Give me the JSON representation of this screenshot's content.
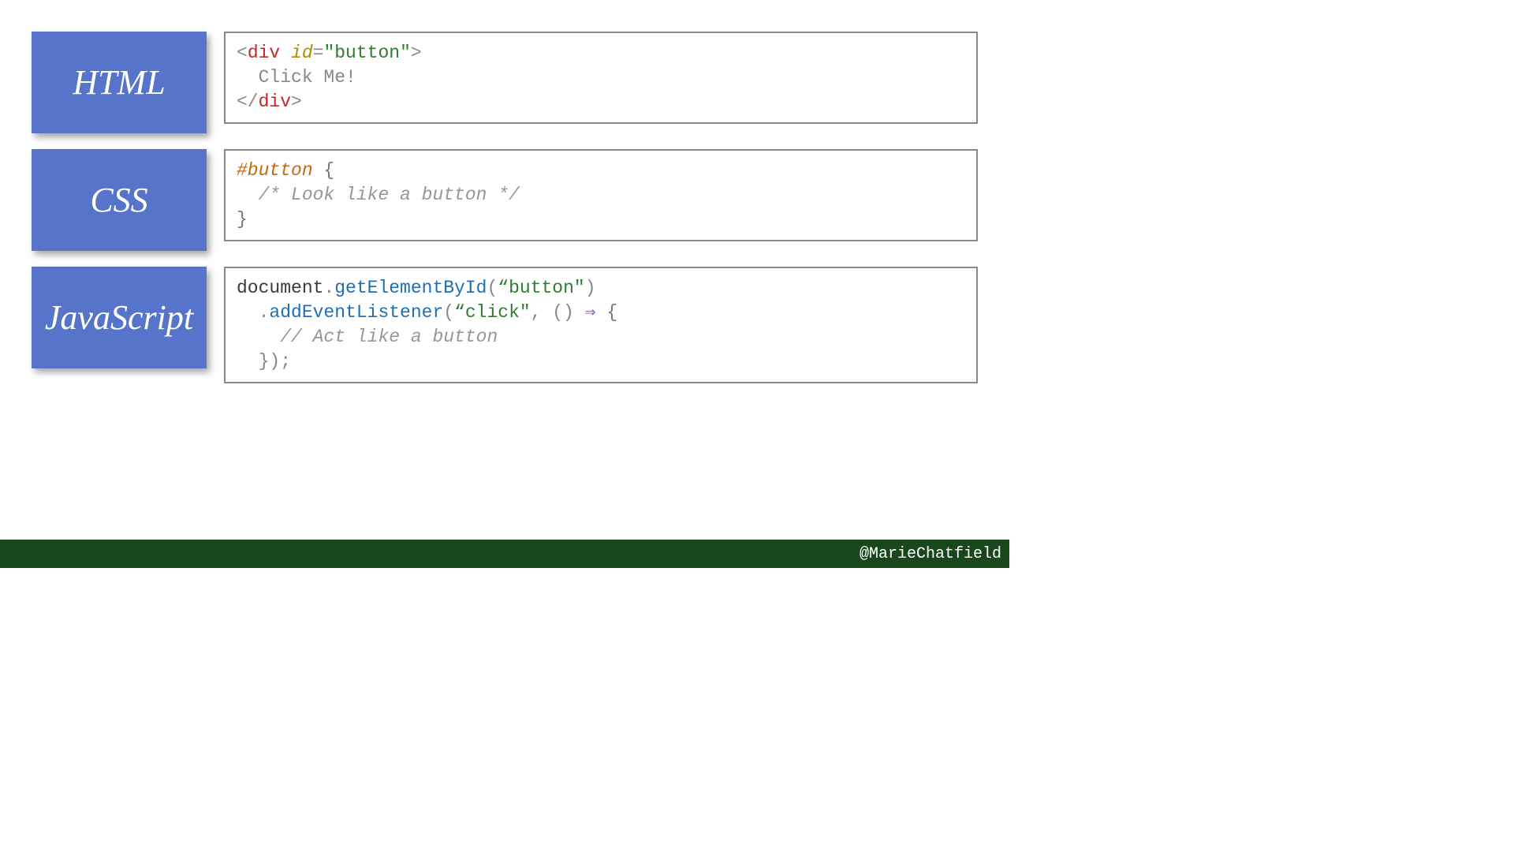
{
  "rows": {
    "html": {
      "label": "HTML",
      "tokens": [
        {
          "text": "<",
          "cls": "c-bracket"
        },
        {
          "text": "div ",
          "cls": "c-tag"
        },
        {
          "text": "id",
          "cls": "c-attr"
        },
        {
          "text": "=",
          "cls": "c-punct"
        },
        {
          "text": "\"button\"",
          "cls": "c-string"
        },
        {
          "text": ">",
          "cls": "c-bracket"
        },
        {
          "text": "\n  Click Me!\n",
          "cls": "c-text"
        },
        {
          "text": "</",
          "cls": "c-bracket"
        },
        {
          "text": "div",
          "cls": "c-tag"
        },
        {
          "text": ">",
          "cls": "c-bracket"
        }
      ]
    },
    "css": {
      "label": "CSS",
      "tokens": [
        {
          "text": "#button ",
          "cls": "c-selector"
        },
        {
          "text": "{",
          "cls": "c-brace"
        },
        {
          "text": "\n  ",
          "cls": "c-text"
        },
        {
          "text": "/* Look like a button */",
          "cls": "c-comment"
        },
        {
          "text": "\n",
          "cls": "c-text"
        },
        {
          "text": "}",
          "cls": "c-brace"
        }
      ]
    },
    "js": {
      "label": "JavaScript",
      "tokens": [
        {
          "text": "document",
          "cls": "c-object"
        },
        {
          "text": ".",
          "cls": "c-dot"
        },
        {
          "text": "getElementById",
          "cls": "c-method"
        },
        {
          "text": "(",
          "cls": "c-punct"
        },
        {
          "text": "“button\"",
          "cls": "c-string"
        },
        {
          "text": ")",
          "cls": "c-punct"
        },
        {
          "text": "\n  ",
          "cls": "c-text"
        },
        {
          "text": ".",
          "cls": "c-dot"
        },
        {
          "text": "addEventListener",
          "cls": "c-method"
        },
        {
          "text": "(",
          "cls": "c-punct"
        },
        {
          "text": "“click\"",
          "cls": "c-string"
        },
        {
          "text": ", () ",
          "cls": "c-punct"
        },
        {
          "text": "⇒",
          "cls": "c-arrow"
        },
        {
          "text": " {",
          "cls": "c-brace"
        },
        {
          "text": "\n    ",
          "cls": "c-text"
        },
        {
          "text": "// Act like a button",
          "cls": "c-comment"
        },
        {
          "text": "\n  });",
          "cls": "c-punct"
        }
      ]
    }
  },
  "footer": {
    "handle": "@MarieChatfield"
  }
}
